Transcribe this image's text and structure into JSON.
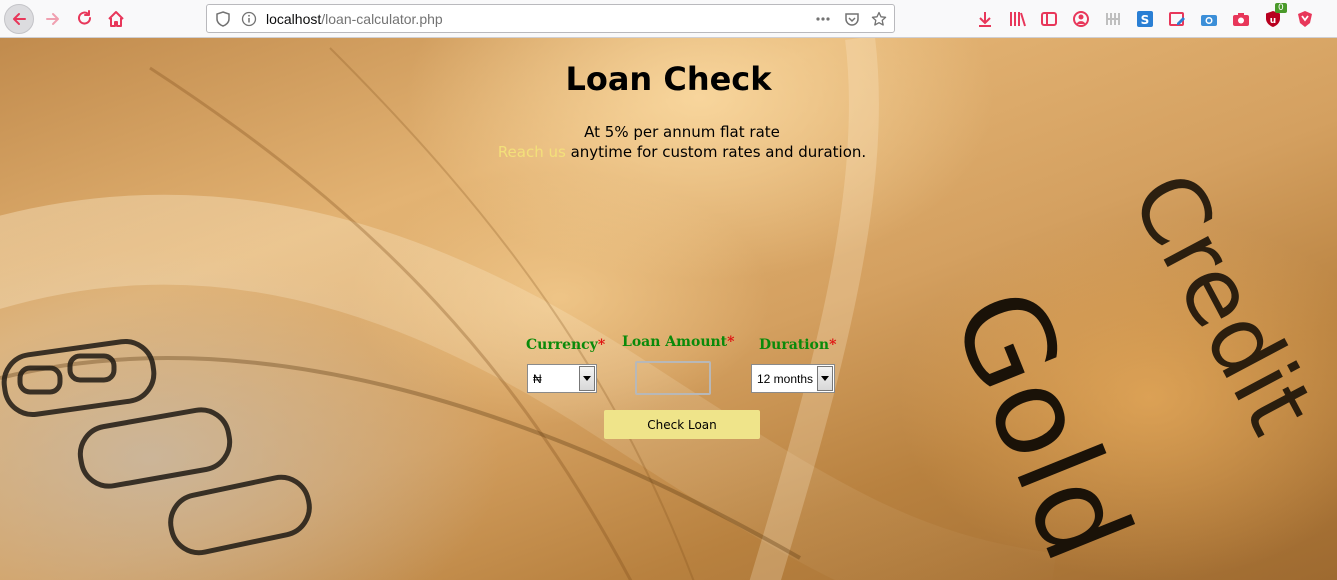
{
  "browser": {
    "url_host": "localhost",
    "url_path": "/loan-calculator.php",
    "ublock_badge": "0"
  },
  "page": {
    "title": "Loan Check",
    "subtitle_line1": "At 5% per annum flat rate",
    "reach_link": "Reach us",
    "subtitle_line2_rest": " anytime for custom rates and duration."
  },
  "form": {
    "currency": {
      "label": "Currency",
      "required_mark": "*",
      "selected": "₦"
    },
    "amount": {
      "label": "Loan Amount",
      "required_mark": "*",
      "value": ""
    },
    "duration": {
      "label": "Duration",
      "required_mark": "*",
      "selected": "12 months"
    },
    "submit_label": "Check Loan"
  },
  "background": {
    "card_text_1": "Gold",
    "card_text_2": "Credit"
  },
  "colors": {
    "label_green": "#0a8a0a",
    "required_red": "#e01010",
    "reach_link": "#f3e07a",
    "button_bg": "#efe48a",
    "toolbar_icon_red": "#e8375a"
  }
}
